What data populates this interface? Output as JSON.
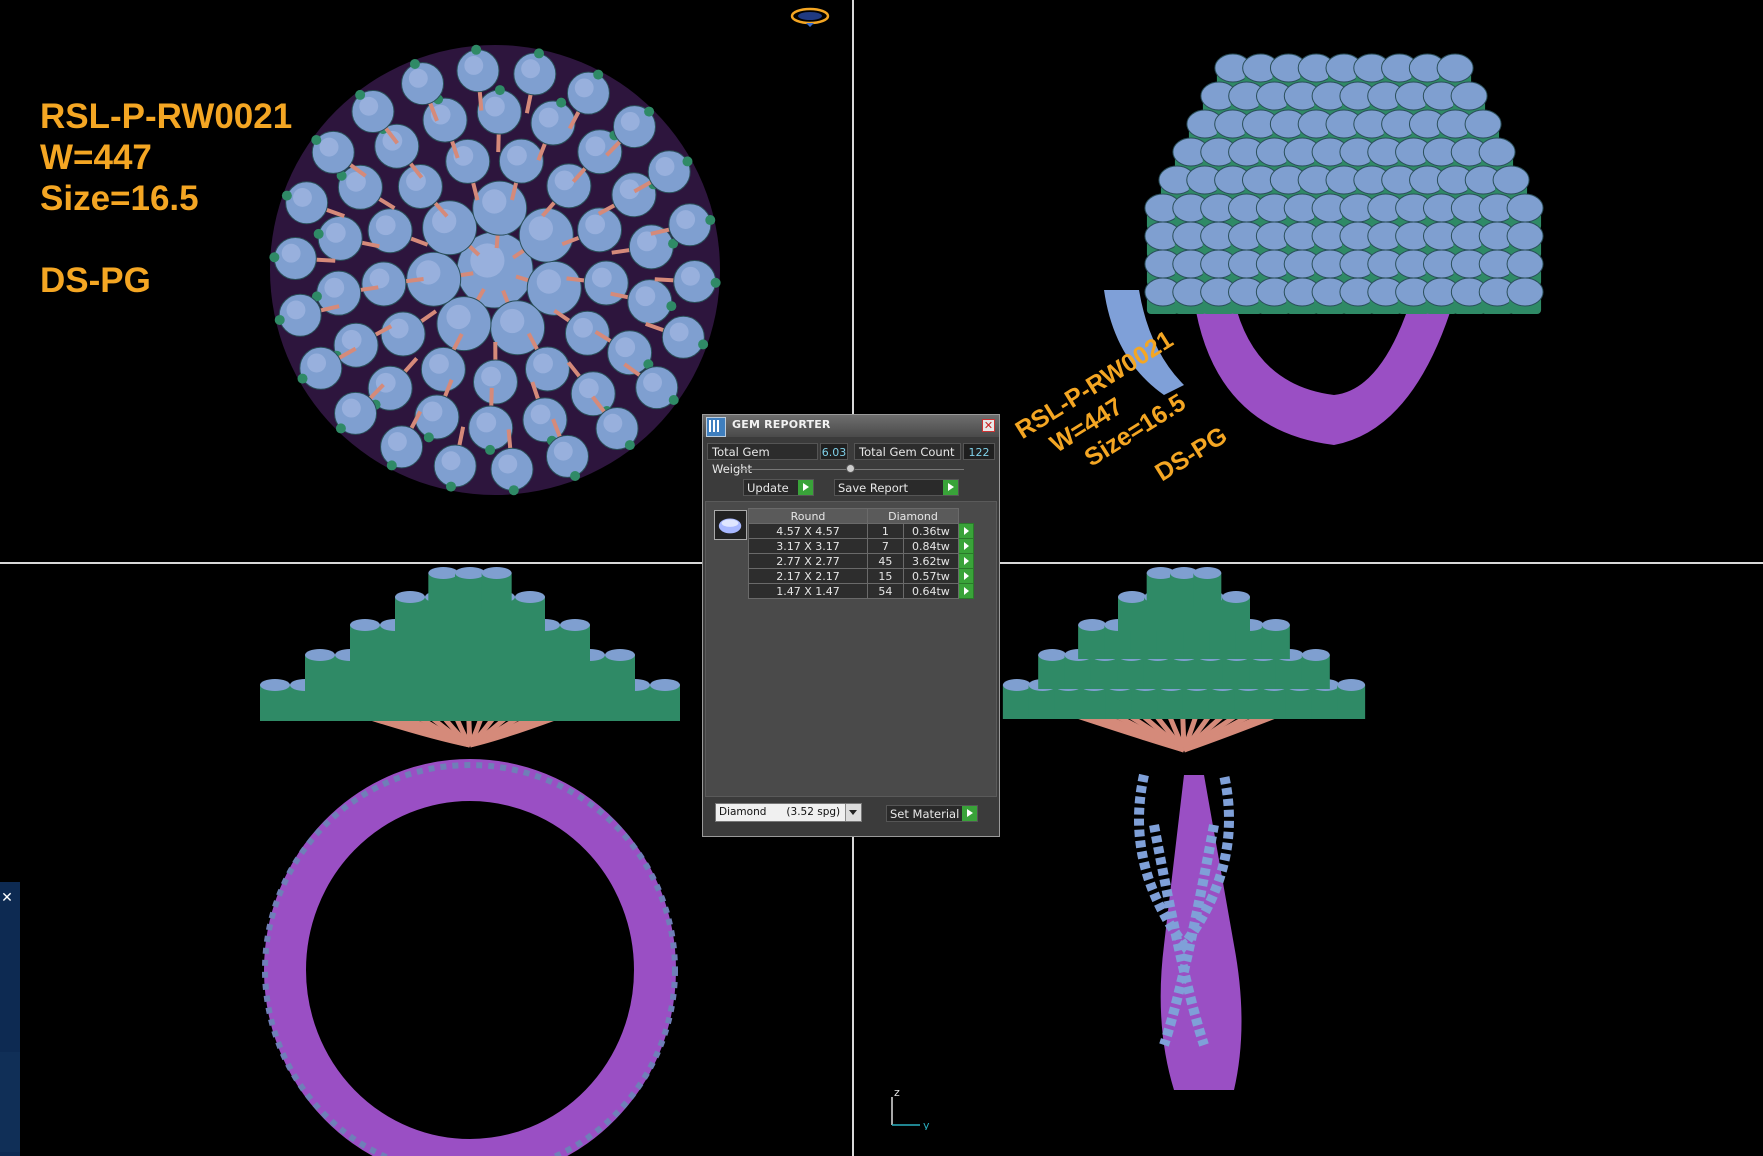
{
  "labels": {
    "design_code": "RSL-P-RW0021",
    "weight": "W=447",
    "size": "Size=16.5",
    "metal": "DS-PG"
  },
  "colors": {
    "label_text": "#f4a623",
    "gem": "#7f9fd0",
    "prong": "#2f8a66",
    "wire": "#d58a7a",
    "shank": "#9a4fc4",
    "background": "#000000"
  },
  "icons": {
    "top_view_cube": "view-cube-icon",
    "axis_gizmo": "axis-icon",
    "window_app": "gem-reporter-app-icon",
    "close": "close-icon",
    "go_arrow": "green-arrow-icon"
  },
  "axes": {
    "z": "z",
    "y": "y"
  },
  "gem_reporter": {
    "title": "GEM REPORTER",
    "total_weight_label": "Total Gem Weight",
    "total_weight_value": "6.03",
    "total_count_label": "Total Gem Count",
    "total_count_value": "122",
    "update_label": "Update",
    "save_report_label": "Save Report",
    "table": {
      "shape_header": "Round",
      "material_header": "Diamond",
      "rows": [
        {
          "size": "4.57 X 4.57",
          "count": "1",
          "weight": "0.36tw"
        },
        {
          "size": "3.17 X 3.17",
          "count": "7",
          "weight": "0.84tw"
        },
        {
          "size": "2.77 X 2.77",
          "count": "45",
          "weight": "3.62tw"
        },
        {
          "size": "2.17 X 2.17",
          "count": "15",
          "weight": "0.57tw"
        },
        {
          "size": "1.47 X 1.47",
          "count": "54",
          "weight": "0.64tw"
        }
      ]
    },
    "material_select": "Diamond      (3.52 spg)",
    "set_material_label": "Set Material"
  }
}
